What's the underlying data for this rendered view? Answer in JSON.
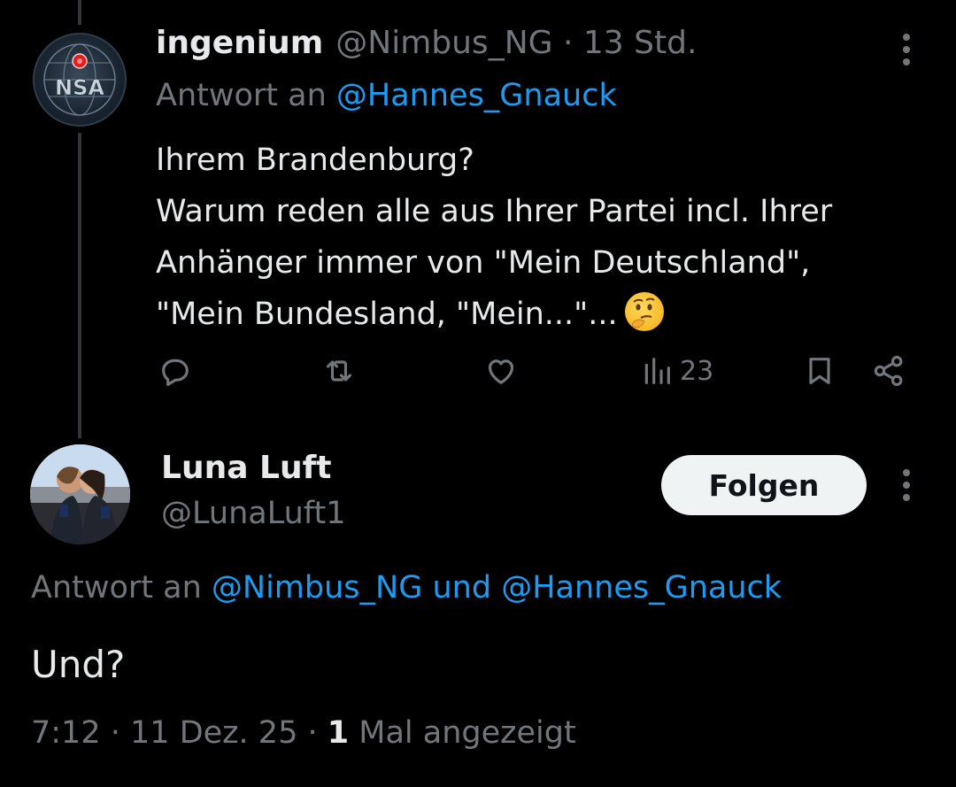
{
  "tweet1": {
    "display_name": "ingenium",
    "handle": "@Nimbus_NG",
    "separator": "·",
    "time": "13 Std.",
    "reply_prefix": "Antwort an",
    "reply_to": "@Hannes_Gnauck",
    "avatar_text": "NSA",
    "body_lines": [
      "Ihrem Brandenburg?",
      "Warum reden alle aus Ihrer Partei incl. Ihrer",
      "Anhänger immer von \"Mein Deutschland\",",
      "\"Mein Bundesland, \"Mein...\"..."
    ],
    "emoji": "thinking-face",
    "views": "23",
    "icons": [
      "reply-icon",
      "repost-icon",
      "like-icon",
      "views-icon",
      "bookmark-icon",
      "share-icon"
    ]
  },
  "tweet2": {
    "display_name": "Luna Luft",
    "handle": "@LunaLuft1",
    "follow_label": "Folgen",
    "reply_prefix": "Antwort an",
    "reply_to_1": "@Nimbus_NG",
    "reply_conj": "und",
    "reply_to_2": "@Hannes_Gnauck",
    "text": "Und?",
    "time": "7:12",
    "date": "11 Dez. 25",
    "views_count": "1",
    "views_label": "Mal angezeigt"
  },
  "colors": {
    "background": "#000000",
    "text": "#e7e9ea",
    "muted": "#71767b",
    "link": "#1d9bf0",
    "button_bg": "#eff3f4"
  }
}
